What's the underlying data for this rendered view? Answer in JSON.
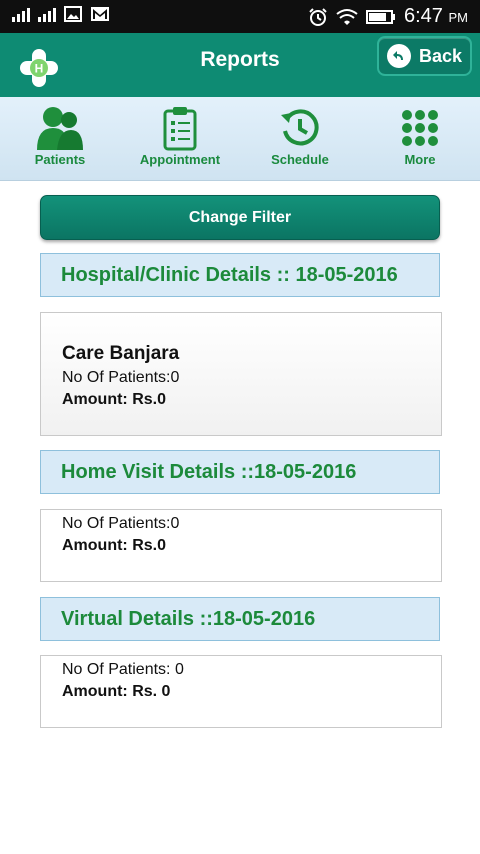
{
  "status_bar": {
    "time": "6:47",
    "ampm": "PM"
  },
  "app_bar": {
    "title": "Reports",
    "back_label": "Back"
  },
  "nav": [
    {
      "label": "Patients",
      "icon": "patients-icon"
    },
    {
      "label": "Appointment",
      "icon": "clipboard-icon"
    },
    {
      "label": "Schedule",
      "icon": "history-clock-icon"
    },
    {
      "label": "More",
      "icon": "grid-dots-icon"
    }
  ],
  "filter_button": "Change Filter",
  "sections": {
    "hospital": {
      "header": "Hospital/Clinic Details :: 18-05-2016",
      "clinic_name": "Care Banjara",
      "patients": "No Of Patients:0",
      "amount": "Amount: Rs.0"
    },
    "home_visit": {
      "header": "Home Visit Details ::18-05-2016",
      "patients": "No Of Patients:0",
      "amount": "Amount: Rs.0"
    },
    "virtual": {
      "header": "Virtual Details ::18-05-2016",
      "patients": "No Of Patients: 0",
      "amount": "Amount: Rs. 0"
    }
  },
  "colors": {
    "app_bar": "#0e8b73",
    "nav_label": "#1a8a3e",
    "header_bg": "#d8eaf7"
  }
}
